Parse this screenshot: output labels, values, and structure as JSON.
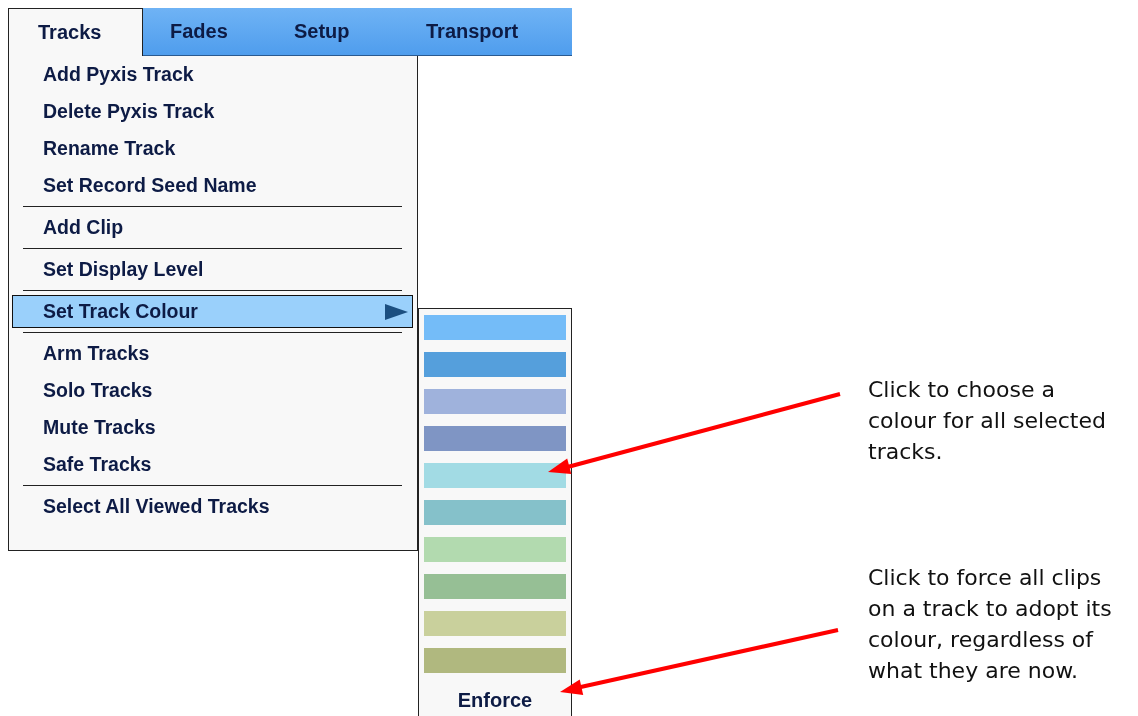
{
  "menu_bar": [
    {
      "label": "Tracks",
      "selected": true
    },
    {
      "label": "Fades",
      "selected": false
    },
    {
      "label": "Setup",
      "selected": false
    },
    {
      "label": "Transport",
      "selected": false
    }
  ],
  "menu": {
    "sections": [
      {
        "items": [
          {
            "label": "Add Pyxis Track",
            "selected": false,
            "submenu": false
          },
          {
            "label": "Delete Pyxis Track",
            "selected": false,
            "submenu": false
          },
          {
            "label": "Rename Track",
            "selected": false,
            "submenu": false
          },
          {
            "label": "Set Record Seed Name",
            "selected": false,
            "submenu": false
          }
        ]
      },
      {
        "items": [
          {
            "label": "Add Clip",
            "selected": false,
            "submenu": false
          }
        ]
      },
      {
        "items": [
          {
            "label": "Set Display Level",
            "selected": false,
            "submenu": false
          }
        ]
      },
      {
        "items": [
          {
            "label": "Set Track Colour",
            "selected": true,
            "submenu": true
          }
        ]
      },
      {
        "items": [
          {
            "label": "Arm Tracks",
            "selected": false,
            "submenu": false
          },
          {
            "label": "Solo Tracks",
            "selected": false,
            "submenu": false
          },
          {
            "label": "Mute Tracks",
            "selected": false,
            "submenu": false
          },
          {
            "label": "Safe Tracks",
            "selected": false,
            "submenu": false
          }
        ]
      },
      {
        "items": [
          {
            "label": "Select All Viewed Tracks",
            "selected": false,
            "submenu": false
          }
        ]
      }
    ]
  },
  "colour_submenu": {
    "swatches": [
      {
        "color": "#74bcf8"
      },
      {
        "color": "#559fdc"
      },
      {
        "color": "#9fb2dc"
      },
      {
        "color": "#7f95c4"
      },
      {
        "color": "#a2dbe4"
      },
      {
        "color": "#85c1ca"
      },
      {
        "color": "#b2daaf"
      },
      {
        "color": "#96bf95"
      },
      {
        "color": "#c9d09c"
      },
      {
        "color": "#b0b87f"
      }
    ],
    "enforce": {
      "label": "Enforce"
    }
  },
  "callouts": [
    {
      "text": "Click to choose a colour for all selected tracks."
    },
    {
      "text": "Click to force all clips on a track to adopt its colour, regardless of what they are now."
    }
  ]
}
